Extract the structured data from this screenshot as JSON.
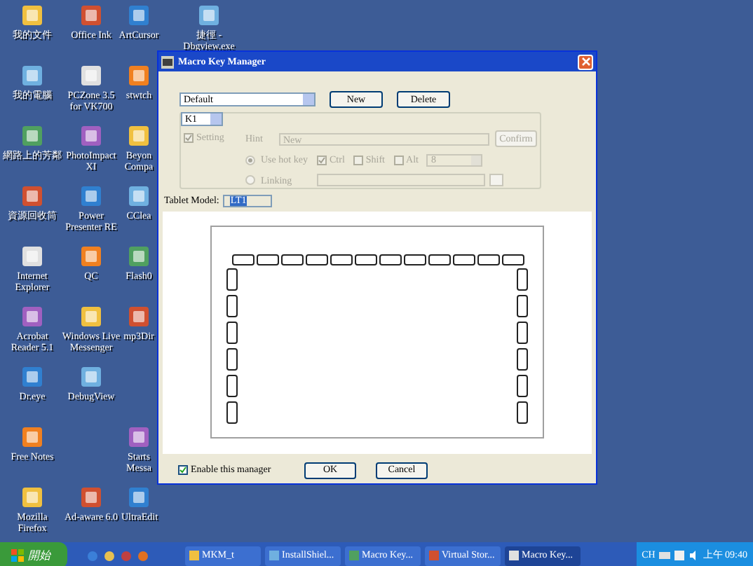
{
  "desktop": {
    "columns": [
      [
        {
          "label": "我的文件"
        },
        {
          "label": "我的電腦"
        },
        {
          "label": "網路上的芳鄰"
        },
        {
          "label": "資源回收筒"
        },
        {
          "label": "Internet Explorer"
        },
        {
          "label": "Acrobat Reader 5.1"
        },
        {
          "label": "Dr.eye"
        },
        {
          "label": "Free Notes"
        },
        {
          "label": "Mozilla Firefox"
        }
      ],
      [
        {
          "label": "Office Ink"
        },
        {
          "label": "PCZone 3.5 for VK700"
        },
        {
          "label": "PhotoImpact XI"
        },
        {
          "label": "Power Presenter RE"
        },
        {
          "label": "QC"
        },
        {
          "label": "Windows Live Messenger"
        },
        {
          "label": "DebugView"
        },
        null,
        {
          "label": "Ad-aware 6.0"
        }
      ],
      [
        {
          "label": "ArtCursor"
        },
        {
          "label": "stwtch"
        },
        {
          "label": "Beyon Compa"
        },
        {
          "label": "CClea"
        },
        {
          "label": "Flash0"
        },
        {
          "label": "mp3Dir"
        },
        null,
        {
          "label": "Starts Messa"
        },
        {
          "label": "UltraEdit"
        }
      ],
      [
        {
          "label": "捷徑 - Dbgview.exe"
        }
      ]
    ]
  },
  "window": {
    "title": "Macro Key Manager",
    "profile": "Default",
    "new_button": "New",
    "delete_button": "Delete",
    "key": "K1",
    "setting": {
      "label": "Setting",
      "checked": true
    },
    "hint_label": "Hint",
    "hint_value": "New",
    "confirm_button": "Confirm",
    "modes": [
      {
        "label": "Use hot key",
        "selected": true
      },
      {
        "label": "Linking",
        "selected": false
      }
    ],
    "modifiers": [
      {
        "label": "Ctrl",
        "checked": true
      },
      {
        "label": "Shift",
        "checked": false
      },
      {
        "label": "Alt",
        "checked": false
      }
    ],
    "hot_key": "8",
    "tablet_model_label": "Tablet Model:",
    "tablet_model": "LT1",
    "enable": {
      "label": "Enable this manager",
      "checked": true
    },
    "ok_button": "OK",
    "cancel_button": "Cancel"
  },
  "taskbar": {
    "start": "開始",
    "tasks": [
      {
        "label": "MKM_t",
        "selected": false
      },
      {
        "label": "InstallShiel...",
        "selected": false
      },
      {
        "label": "Macro Key...",
        "selected": false
      },
      {
        "label": "Virtual Stor...",
        "selected": false
      },
      {
        "label": "Macro Key...",
        "selected": true
      }
    ],
    "language": "CH",
    "clock": "上午 09:40"
  }
}
